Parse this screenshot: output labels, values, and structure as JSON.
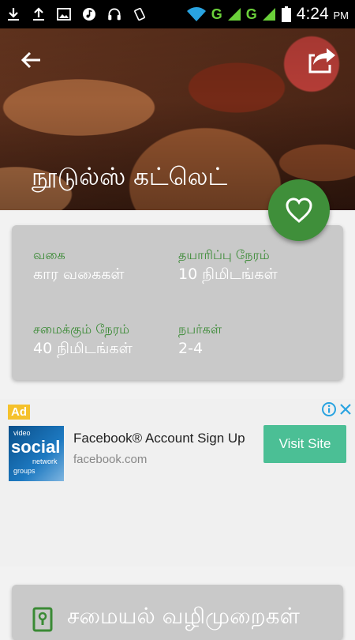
{
  "status_bar": {
    "time": "4:24",
    "ampm": "PM",
    "signal_1": "G",
    "signal_2": "G",
    "icons": [
      "download-icon",
      "upload-icon",
      "image-icon",
      "music-icon",
      "headset-icon",
      "vibrate-icon",
      "wifi-icon",
      "signal-icon",
      "battery-icon"
    ]
  },
  "header": {
    "title": "நூடுல்ஸ் கட்லெட்",
    "back_icon": "arrow-back-icon",
    "share_icon": "share-icon",
    "favorite_icon": "heart-outline-icon"
  },
  "info": {
    "category_label": "வகை",
    "category_value": "கார வகைகள்",
    "prep_label": "தயாரிப்பு நேரம்",
    "prep_value": "10 நிமிடங்கள்",
    "cook_label": "சமைக்கும் நேரம்",
    "cook_value": "40 நிமிடங்கள்",
    "serves_label": "நபர்கள்",
    "serves_value": "2-4"
  },
  "ad": {
    "badge": "Ad",
    "title": "Facebook® Account Sign Up",
    "domain": "facebook.com",
    "cta": "Visit Site",
    "thumb_words": [
      "video",
      "social",
      "network",
      "groups"
    ]
  },
  "method": {
    "title": "சமையல் வழிமுறைகள்",
    "icon": "book-icon"
  },
  "colors": {
    "accent_green": "#3f8f3a",
    "card_gray": "#c9c9c9",
    "cta_green": "#4bbf95",
    "ad_badge": "#f5c12b"
  }
}
